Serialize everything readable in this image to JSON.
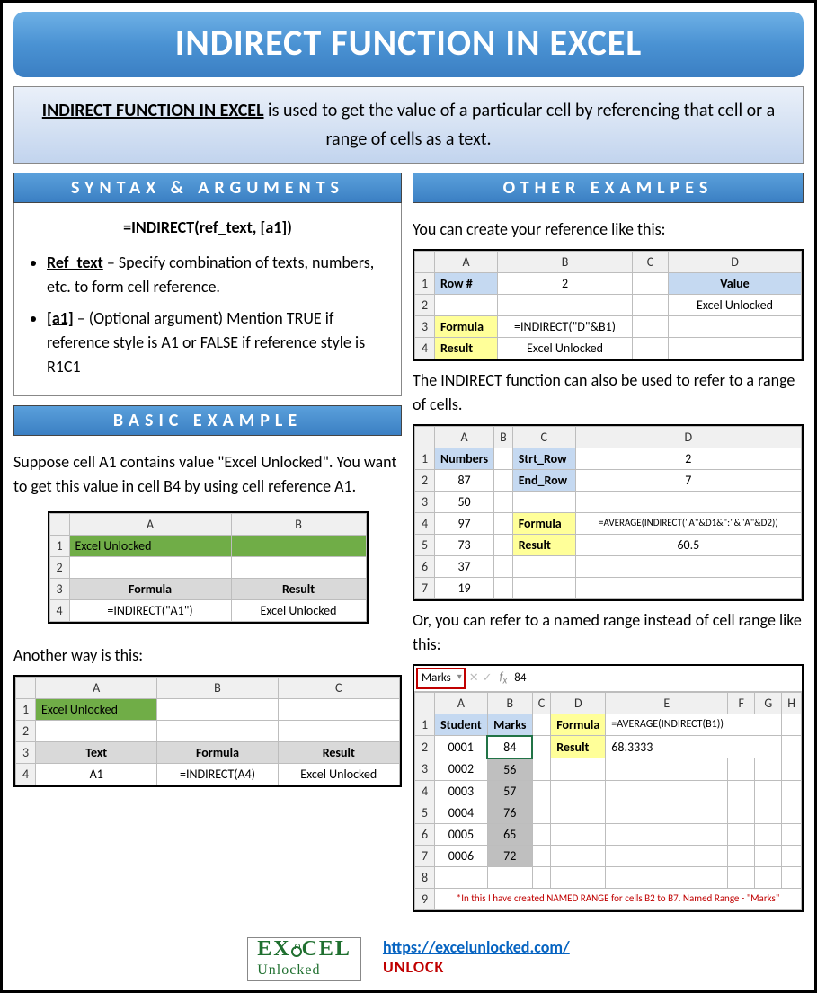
{
  "title": "INDIRECT FUNCTION IN EXCEL",
  "intro": {
    "lead": "INDIRECT FUNCTION IN EXCEL",
    "rest": " is used to get the value of a particular cell by referencing that cell or a range of cells as a text."
  },
  "syntax": {
    "header": "SYNTAX & ARGUMENTS",
    "formula": "=INDIRECT(ref_text, [a1])",
    "args": [
      {
        "name": "Ref_text",
        "desc": " – Specify combination of texts, numbers, etc. to form cell reference."
      },
      {
        "name": "[a1]",
        "desc": " – (Optional argument) Mention TRUE if reference style is A1 or FALSE if reference style is R1C1"
      }
    ]
  },
  "basic": {
    "header": "BASIC EXAMPLE",
    "p1": "Suppose cell A1 contains value \"Excel Unlocked\". You want to get this value in cell B4 by using cell reference A1.",
    "tbl1": {
      "cols": [
        "A",
        "B"
      ],
      "a1": "Excel Unlocked",
      "r3": [
        "Formula",
        "Result"
      ],
      "r4": [
        "=INDIRECT(\"A1\")",
        "Excel Unlocked"
      ]
    },
    "p2": "Another way is this:",
    "tbl2": {
      "cols": [
        "A",
        "B",
        "C"
      ],
      "a1": "Excel Unlocked",
      "r3": [
        "Text",
        "Formula",
        "Result"
      ],
      "r4": [
        "A1",
        "=INDIRECT(A4)",
        "Excel Unlocked"
      ]
    }
  },
  "other": {
    "header": "OTHER EXAMLPES",
    "p1": "You can create your reference like this:",
    "tbl1": {
      "cols": [
        "A",
        "B",
        "C",
        "D"
      ],
      "r1": [
        "Row #",
        "2",
        "",
        "Value"
      ],
      "r2_d": "Excel Unlocked",
      "r3": [
        "Formula",
        "=INDIRECT(\"D\"&B1)"
      ],
      "r4": [
        "Result",
        "Excel Unlocked"
      ]
    },
    "p2": "The INDIRECT function can also be used to refer to a range of cells.",
    "tbl2": {
      "cols": [
        "A",
        "B",
        "C",
        "D"
      ],
      "numbers_h": "Numbers",
      "numbers": [
        "87",
        "50",
        "97",
        "73",
        "37",
        "19"
      ],
      "strt": "Strt_Row",
      "strt_v": "2",
      "end": "End_Row",
      "end_v": "7",
      "formula_l": "Formula",
      "formula_v": "=AVERAGE(INDIRECT(\"A\"&D1&\":\"&\"A\"&D2))",
      "result_l": "Result",
      "result_v": "60.5"
    },
    "p3": "Or, you can refer to a named range instead of cell range like this:",
    "tbl3": {
      "namebox": "Marks",
      "fx_val": "84",
      "cols": [
        "A",
        "B",
        "C",
        "D",
        "E",
        "F",
        "G",
        "H"
      ],
      "h": [
        "Student",
        "Marks"
      ],
      "rows": [
        [
          "0001",
          "84"
        ],
        [
          "0002",
          "56"
        ],
        [
          "0003",
          "57"
        ],
        [
          "0004",
          "76"
        ],
        [
          "0005",
          "65"
        ],
        [
          "0006",
          "72"
        ]
      ],
      "formula_l": "Formula",
      "formula_v": "=AVERAGE(INDIRECT(B1))",
      "result_l": "Result",
      "result_v": "68.3333",
      "note": "*In this I have created NAMED RANGE for cells B2 to B7. Named Range - \"Marks\""
    }
  },
  "footer": {
    "logo_line1a": "EX",
    "logo_line1b": "CEL",
    "logo_line2": "Unlocked",
    "url": "https://excelunlocked.com/",
    "unlock": "UNLOCK"
  }
}
